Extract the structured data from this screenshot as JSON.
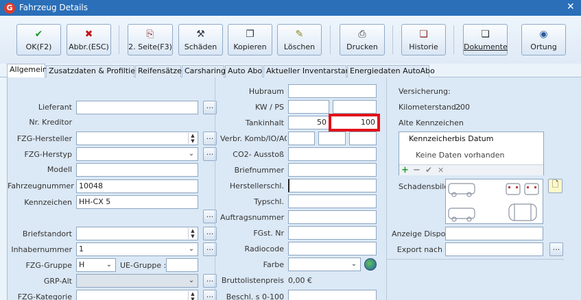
{
  "window": {
    "title": "Fahrzeug Details",
    "app_icon_glyph": "G",
    "close_glyph": "✕"
  },
  "toolbar": {
    "buttons": [
      {
        "label": "OK(F2)",
        "icon": "checkmark-icon",
        "glyph": "✔",
        "color": "#1c9a2e"
      },
      {
        "label": "Abbr.(ESC)",
        "icon": "cancel-icon",
        "glyph": "✖",
        "color": "#c21717"
      },
      {
        "label": "2. Seite(F3)",
        "icon": "page-icon",
        "glyph": "⎘",
        "color": "#8a3a3a"
      },
      {
        "label": "Schäden",
        "icon": "damage-icon",
        "glyph": "⚒",
        "color": "#334"
      },
      {
        "label": "Kopieren",
        "icon": "copy-icon",
        "glyph": "❐",
        "color": "#334"
      },
      {
        "label": "Löschen",
        "icon": "delete-icon",
        "glyph": "✎",
        "color": "#8a8a1a"
      },
      {
        "label": "Drucken",
        "icon": "printer-icon",
        "glyph": "⎙",
        "color": "#333"
      },
      {
        "label": "Historie",
        "icon": "history-icon",
        "glyph": "❏",
        "color": "#8a2a2a"
      },
      {
        "label": "Dokumente",
        "icon": "documents-icon",
        "glyph": "❏",
        "color": "#333"
      },
      {
        "label": "Ortung",
        "icon": "globe-icon",
        "glyph": "◉",
        "color": "#2a5c9a"
      }
    ]
  },
  "tabs": [
    "Allgemein",
    "Zusatzdaten & Profiltiefen",
    "Reifensätze",
    "Carsharing",
    "Auto Abo",
    "Aktueller Inventarstand",
    "Energiedaten AutoAbo"
  ],
  "left": {
    "lieferant": {
      "label": "Lieferant",
      "value": ""
    },
    "kreditor": {
      "label": "Nr. Kreditor"
    },
    "hersteller": {
      "label": "FZG-Hersteller",
      "value": ""
    },
    "herstyp": {
      "label": "FZG-Herstyp",
      "value": ""
    },
    "modell": {
      "label": "Modell",
      "value": ""
    },
    "fahrzeugnummer": {
      "label": "Fahrzeugnummer",
      "value": "10048"
    },
    "kennzeichen": {
      "label": "Kennzeichen",
      "value": "HH-CX 5"
    },
    "briefstandort": {
      "label": "Briefstandort",
      "value": ""
    },
    "inhabernummer": {
      "label": "Inhabernummer",
      "value": "1"
    },
    "fzg_gruppe": {
      "label": "FZG-Gruppe",
      "value": "H"
    },
    "ue_gruppe": {
      "label": "UE-Gruppe :",
      "value": ""
    },
    "grp_alt": {
      "label": "GRP-Alt",
      "value": ""
    },
    "fzg_kategorie": {
      "label": "FZG-Kategorie",
      "value": ""
    },
    "dots": "..."
  },
  "middle": {
    "hubraum": {
      "label": "Hubraum",
      "value": ""
    },
    "kw_ps": {
      "label": "KW / PS",
      "value1": "",
      "value2": ""
    },
    "tankinhalt": {
      "label": "Tankinhalt",
      "value1": "50",
      "value2": "100"
    },
    "verbr": {
      "label": "Verbr. Komb/IO/AO"
    },
    "co2": {
      "label": "CO2- Ausstoß",
      "value": ""
    },
    "briefnummer": {
      "label": "Briefnummer",
      "value": ""
    },
    "herstellerschl": {
      "label": "Herstellerschl.",
      "value": ""
    },
    "typschl": {
      "label": "Typschl.",
      "value": ""
    },
    "auftragsnummer": {
      "label": "Auftragsnummer",
      "value": ""
    },
    "fgst": {
      "label": "FGst. Nr",
      "value": ""
    },
    "radiocode": {
      "label": "Radiocode",
      "value": ""
    },
    "farbe": {
      "label": "Farbe",
      "value": ""
    },
    "bruttolistenpreis": {
      "label": "Bruttolistenpreis",
      "value": "0,00 €"
    },
    "beschl": {
      "label": "Beschl. s 0-100",
      "value": ""
    }
  },
  "right": {
    "versicherung": "Versicherung:",
    "kilometerstand_label": "Kilometerstand :",
    "kilometerstand_value": "200",
    "alte_kennzeichen": "Alte Kennzeichen",
    "list_col1": "Kennzeicher",
    "list_col2": "bis Datum",
    "list_empty": "Keine Daten vorhanden",
    "schadensbild": "Schadensbild",
    "anzeige_dispo": "Anzeige Dispo",
    "export_nach": "Export nach",
    "dots": "..."
  },
  "colors": {
    "title_bar": "#2a6fb8",
    "highlight": "#e3121a",
    "panel": "#dbe8f5"
  }
}
